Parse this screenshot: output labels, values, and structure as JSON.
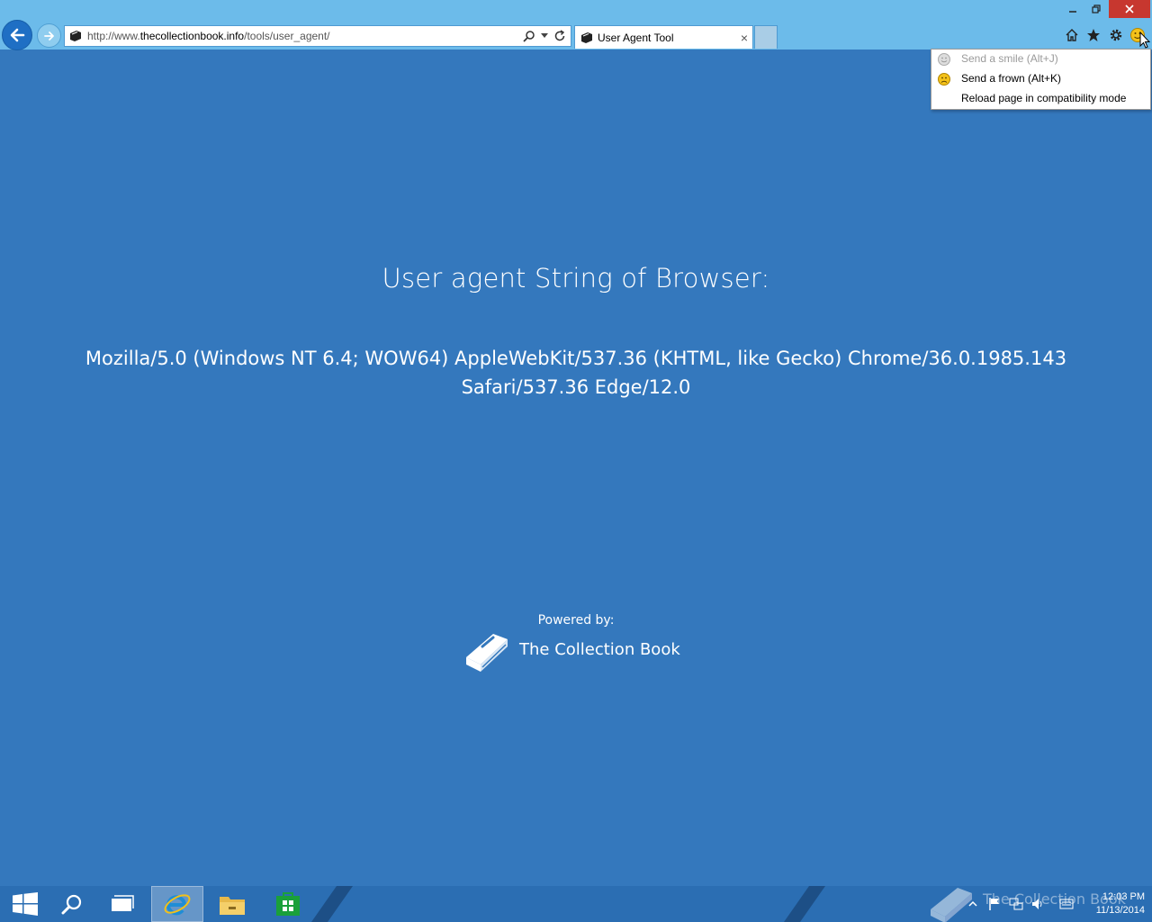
{
  "browser": {
    "url_prefix": "http://www.",
    "url_domain": "thecollectionbook.info",
    "url_path": "/tools/user_agent/",
    "tab_title": "User Agent Tool",
    "tab_close": "×"
  },
  "feedback_menu": {
    "items": [
      {
        "label": "Send a smile (Alt+J)",
        "enabled": false,
        "icon": "smile-icon"
      },
      {
        "label": "Send a frown (Alt+K)",
        "enabled": true,
        "icon": "frown-icon"
      },
      {
        "label": "Reload page in compatibility mode",
        "enabled": true,
        "icon": ""
      }
    ]
  },
  "page": {
    "heading": "User agent String of Browser:",
    "user_agent": "Mozilla/5.0 (Windows NT 6.4; WOW64) AppleWebKit/537.36 (KHTML, like Gecko) Chrome/36.0.1985.143 Safari/537.36 Edge/12.0",
    "powered_label": "Powered by:",
    "brand_name": "The Collection Book"
  },
  "taskbar": {
    "watermark": "The Collection Book",
    "time": "12:03 PM",
    "date": "11/13/2014"
  },
  "colors": {
    "page_background": "#3478bd",
    "chrome_background": "#6cbbea",
    "taskbar_background": "#2b6eb3"
  }
}
